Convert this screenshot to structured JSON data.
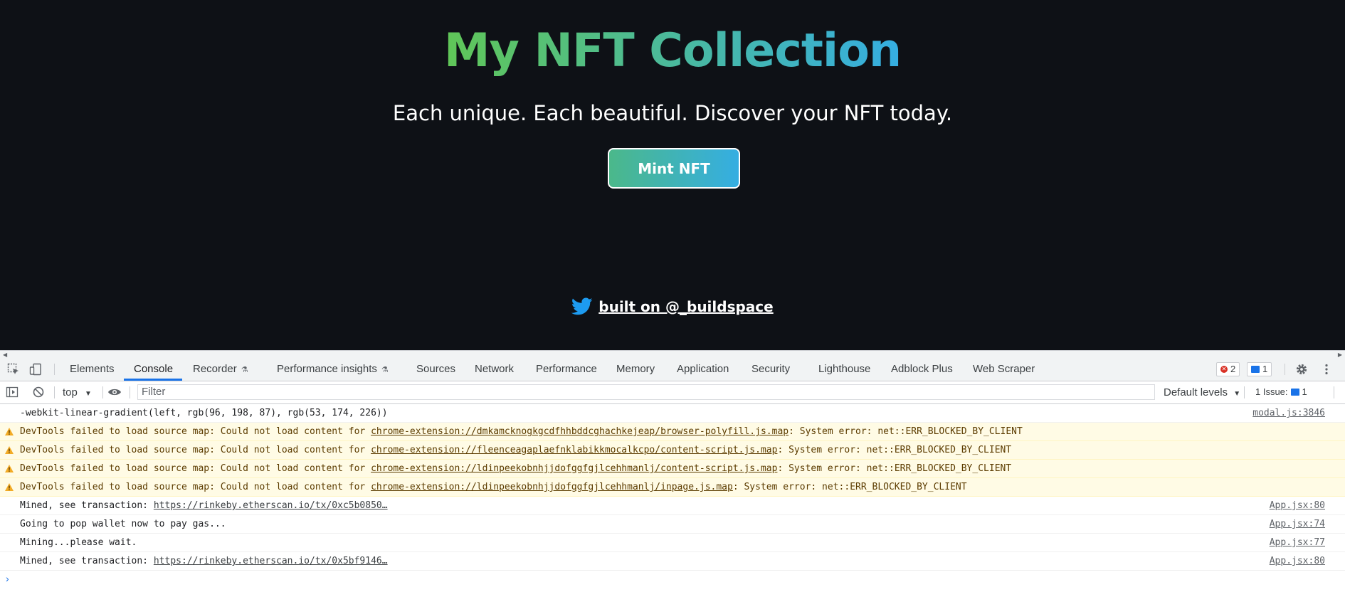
{
  "app": {
    "title": "My NFT Collection",
    "subtitle": "Each unique. Each beautiful. Discover your NFT today.",
    "mint_button": "Mint NFT",
    "footer_link": "built on @_buildspace",
    "gradient_start": "#60c657",
    "gradient_end": "#35aee2"
  },
  "devtools": {
    "tabs": [
      "Elements",
      "Console",
      "Recorder",
      "Performance insights",
      "Sources",
      "Network",
      "Performance",
      "Memory",
      "Application",
      "Security",
      "Lighthouse",
      "Adblock Plus",
      "Web Scraper"
    ],
    "active_tab": "Console",
    "error_count": "2",
    "message_count": "1",
    "context": "top",
    "filter_placeholder": "Filter",
    "levels": "Default levels",
    "issues": "1 Issue:",
    "issues_count": "1"
  },
  "console": {
    "rows": [
      {
        "type": "log",
        "text": "-webkit-linear-gradient(left, rgb(96, 198, 87), rgb(53, 174, 226))",
        "link": "",
        "suffix": "",
        "source": "modal.js:3846"
      },
      {
        "type": "warn",
        "text": "DevTools failed to load source map: Could not load content for ",
        "link": "chrome-extension://dmkamcknogkgcdfhhbddcghachkejeap/browser-polyfill.js.map",
        "suffix": ": System error: net::ERR_BLOCKED_BY_CLIENT",
        "source": ""
      },
      {
        "type": "warn",
        "text": "DevTools failed to load source map: Could not load content for ",
        "link": "chrome-extension://fleenceagaplaefnklabikkmocalkcpo/content-script.js.map",
        "suffix": ": System error: net::ERR_BLOCKED_BY_CLIENT",
        "source": ""
      },
      {
        "type": "warn",
        "text": "DevTools failed to load source map: Could not load content for ",
        "link": "chrome-extension://ldinpeekobnhjjdofggfgjlcehhmanlj/content-script.js.map",
        "suffix": ": System error: net::ERR_BLOCKED_BY_CLIENT",
        "source": ""
      },
      {
        "type": "warn",
        "text": "DevTools failed to load source map: Could not load content for ",
        "link": "chrome-extension://ldinpeekobnhjjdofggfgjlcehhmanlj/inpage.js.map",
        "suffix": ": System error: net::ERR_BLOCKED_BY_CLIENT",
        "source": ""
      },
      {
        "type": "log",
        "text": "Mined, see transaction: ",
        "link": "https://rinkeby.etherscan.io/tx/0xc5b0850…",
        "suffix": "",
        "source": "App.jsx:80"
      },
      {
        "type": "log",
        "text": "Going to pop wallet now to pay gas...",
        "link": "",
        "suffix": "",
        "source": "App.jsx:74"
      },
      {
        "type": "log",
        "text": "Mining...please wait.",
        "link": "",
        "suffix": "",
        "source": "App.jsx:77"
      },
      {
        "type": "log",
        "text": "Mined, see transaction: ",
        "link": "https://rinkeby.etherscan.io/tx/0x5bf9146…",
        "suffix": "",
        "source": "App.jsx:80"
      }
    ],
    "prompt": "›"
  }
}
